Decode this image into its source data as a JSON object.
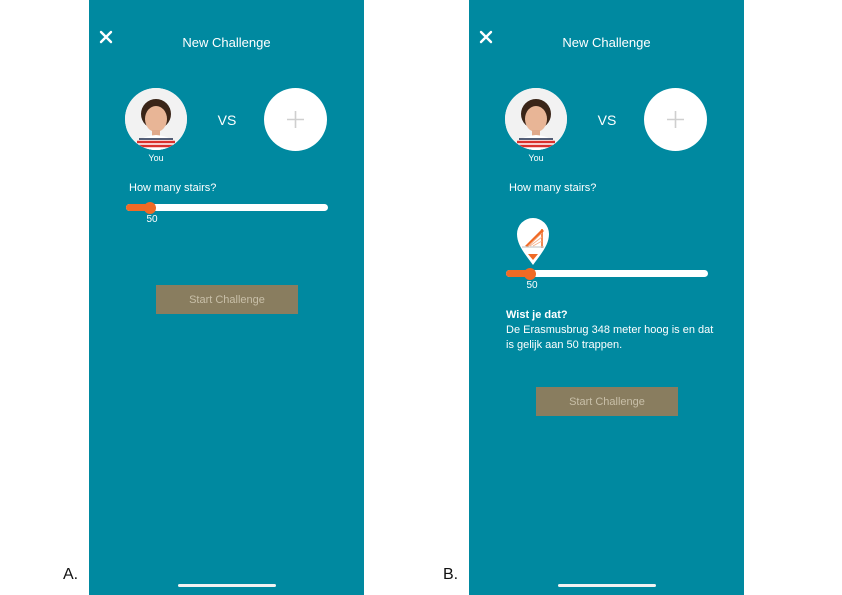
{
  "panels": [
    {
      "label": "A.",
      "title": "New Challenge",
      "player_label": "You",
      "vs_text": "VS",
      "question": "How many stairs?",
      "slider": {
        "value": 50,
        "fraction": 0.12
      },
      "start_button": "Start Challenge"
    },
    {
      "label": "B.",
      "title": "New Challenge",
      "player_label": "You",
      "vs_text": "VS",
      "question": "How many stairs?",
      "slider": {
        "value": 50,
        "fraction": 0.12
      },
      "fact_heading": "Wist je dat?",
      "fact_text": "De Erasmusbrug 348 meter hoog is en dat is gelijk aan 50 trappen.",
      "start_button": "Start Challenge"
    }
  ],
  "colors": {
    "screen_bg": "#0089a0",
    "slider_accent": "#f06a25",
    "button_bg": "#897d5f",
    "button_text": "#c8bfa8"
  },
  "icons": {
    "close": "close-icon",
    "add": "plus-icon",
    "landmark": "erasmusbrug-pin-icon"
  }
}
